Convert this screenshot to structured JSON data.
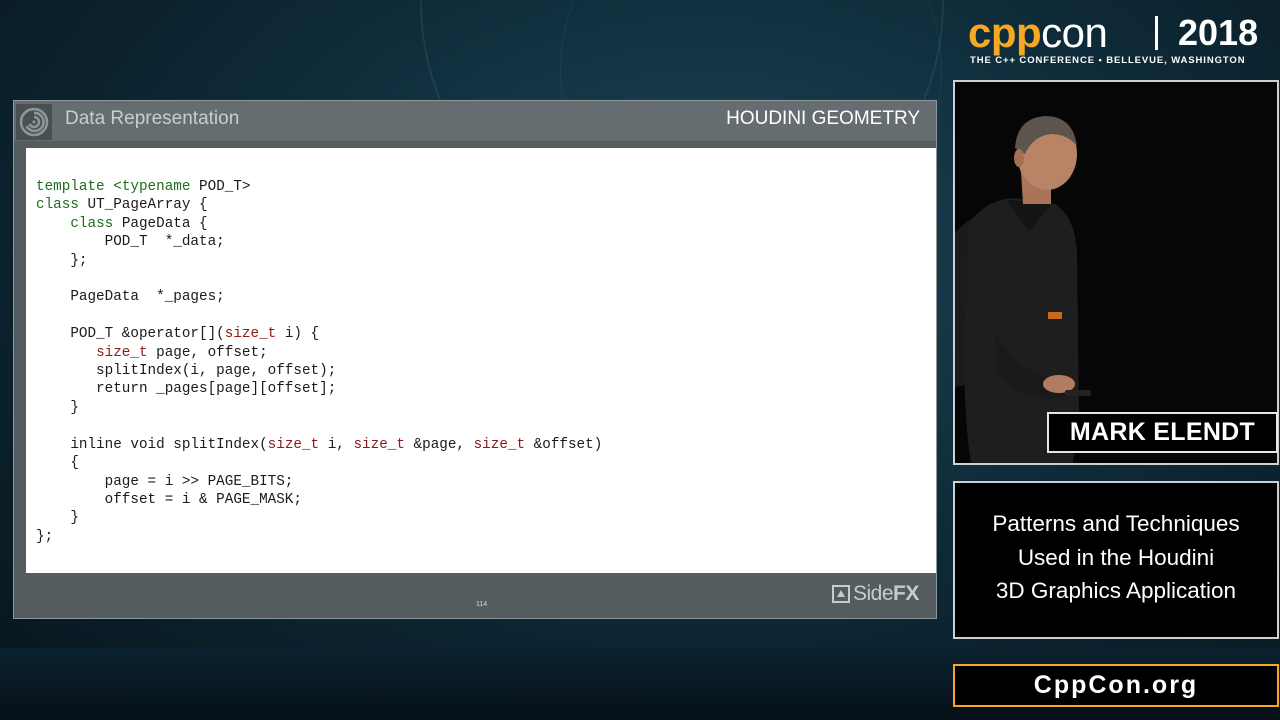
{
  "logo": {
    "cpp": "cpp",
    "con": "con",
    "year": "2018",
    "tagline": "THE C++ CONFERENCE • BELLEVUE, WASHINGTON",
    "accent_color": "#f7a823"
  },
  "slide": {
    "title": "Data Representation",
    "section": "HOUDINI GEOMETRY",
    "page_number": "114",
    "brand_side": "Side",
    "brand_fx": "FX",
    "code_lines": [
      [
        {
          "t": "template",
          "c": "kw"
        },
        {
          "t": " "
        },
        {
          "t": "<typename",
          "c": "kw"
        },
        {
          "t": " POD_T>"
        }
      ],
      [
        {
          "t": "class",
          "c": "kw"
        },
        {
          "t": " UT_PageArray {"
        }
      ],
      [
        {
          "t": "    "
        },
        {
          "t": "class",
          "c": "kw"
        },
        {
          "t": " PageData {"
        }
      ],
      [
        {
          "t": "        POD_T  *_data;"
        }
      ],
      [
        {
          "t": "    };"
        }
      ],
      [
        {
          "t": ""
        }
      ],
      [
        {
          "t": "    PageData  *_pages;"
        }
      ],
      [
        {
          "t": ""
        }
      ],
      [
        {
          "t": "    POD_T &operator[]("
        },
        {
          "t": "size_t",
          "c": "ty"
        },
        {
          "t": " i) {"
        }
      ],
      [
        {
          "t": "       "
        },
        {
          "t": "size_t",
          "c": "ty"
        },
        {
          "t": " page, offset;"
        }
      ],
      [
        {
          "t": "       splitIndex(i, page, offset);"
        }
      ],
      [
        {
          "t": "       return _pages[page][offset];"
        }
      ],
      [
        {
          "t": "    }"
        }
      ],
      [
        {
          "t": ""
        }
      ],
      [
        {
          "t": "    inline void splitIndex("
        },
        {
          "t": "size_t",
          "c": "ty"
        },
        {
          "t": " i, "
        },
        {
          "t": "size_t",
          "c": "ty"
        },
        {
          "t": " &page, "
        },
        {
          "t": "size_t",
          "c": "ty"
        },
        {
          "t": " &offset)"
        }
      ],
      [
        {
          "t": "    {"
        }
      ],
      [
        {
          "t": "        page = i >> PAGE_BITS;"
        }
      ],
      [
        {
          "t": "        offset = i & PAGE_MASK;"
        }
      ],
      [
        {
          "t": "    }"
        }
      ],
      [
        {
          "t": "};"
        }
      ]
    ]
  },
  "speaker": {
    "name": "MARK ELENDT"
  },
  "talk": {
    "title_lines": [
      "Patterns and Techniques",
      "Used in the Houdini",
      "3D Graphics Application"
    ]
  },
  "footer": {
    "url": "CppCon.org"
  },
  "icons": {
    "slide_logo": "houdini-swirl-icon",
    "brand_mark": "sidefx-logo-icon"
  }
}
